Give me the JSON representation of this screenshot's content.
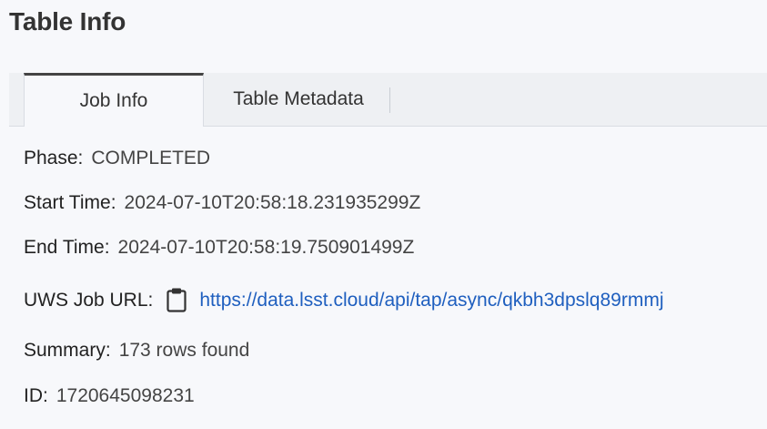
{
  "page": {
    "title": "Table Info"
  },
  "tabs": [
    {
      "label": "Job Info",
      "active": true
    },
    {
      "label": "Table Metadata",
      "active": false
    }
  ],
  "job_info": {
    "phase_label": "Phase:",
    "phase_value": "COMPLETED",
    "start_label": "Start Time:",
    "start_value": "2024-07-10T20:58:18.231935299Z",
    "end_label": "End Time:",
    "end_value": "2024-07-10T20:58:19.750901499Z",
    "url_label": "UWS Job URL:",
    "url_value": "https://data.lsst.cloud/api/tap/async/qkbh3dpslq89rmmj",
    "copy_icon": "clipboard-icon",
    "summary_label": "Summary:",
    "summary_value": "173 rows found",
    "id_label": "ID:",
    "id_value": "1720645098231"
  },
  "colors": {
    "link": "#1f5fbf",
    "active_tab_border": "#444444",
    "background": "#f7f8fb"
  }
}
